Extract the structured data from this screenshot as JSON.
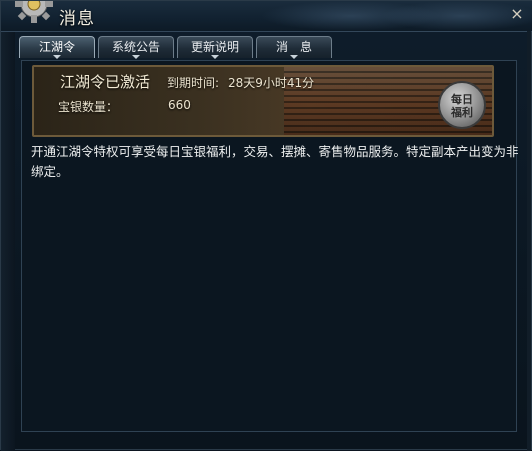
{
  "window": {
    "title": "消息",
    "close_glyph": "×"
  },
  "tabs": [
    {
      "label": "江湖令",
      "active": true
    },
    {
      "label": "系统公告",
      "active": false
    },
    {
      "label": "更新说明",
      "active": false
    },
    {
      "label": "消　息",
      "active": false
    }
  ],
  "banner": {
    "title": "江湖令已激活",
    "expire_label": "到期时间:",
    "expire_value": "28天9小时41分",
    "amount_label": "宝银数量：",
    "amount_value": "660",
    "badge_line1": "每日",
    "badge_line2": "福利"
  },
  "description": "开通江湖令特权可享受每日宝银福利，交易、摆摊、寄售物品服务。特定副本产出变为非绑定。",
  "icons": {
    "gear": "gear-icon",
    "close": "close-icon",
    "tab_arrow": "chevron-down-icon"
  },
  "colors": {
    "accent_gold": "#b89a5e",
    "text_light": "#eef0f0",
    "panel_bg": "#0b1620"
  }
}
